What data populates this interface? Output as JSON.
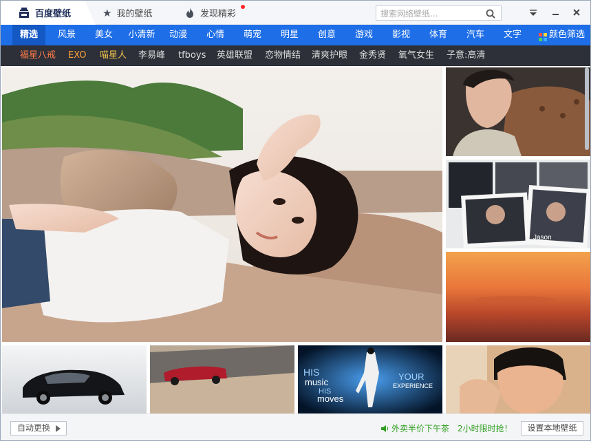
{
  "titlebar": {
    "tabs": [
      {
        "label": "百度壁纸",
        "icon": "baidu-wallpaper-logo-icon"
      },
      {
        "label": "我的壁纸",
        "icon": "star-icon"
      },
      {
        "label": "发现精彩",
        "icon": "flame-icon",
        "badge": "new-dot"
      }
    ],
    "search": {
      "placeholder": "搜索网络壁纸..."
    },
    "window_buttons": [
      "menu-icon",
      "minimize-icon",
      "close-icon"
    ]
  },
  "categories": {
    "items": [
      "精选",
      "风景",
      "美女",
      "小清新",
      "动漫",
      "心情",
      "萌宠",
      "明星",
      "创意",
      "游戏",
      "影视",
      "体育",
      "汽车",
      "文字",
      "颜色筛选"
    ],
    "active": "精选"
  },
  "tags": {
    "items": [
      "福星八戒",
      "EXO",
      "喵星人",
      "李易峰",
      "tfboys",
      "英雄联盟",
      "恋物情结",
      "清爽护眼",
      "金秀贤",
      "氧气女生",
      "子意:高清"
    ],
    "colors": [
      "#ff7a45",
      "#ffa23a",
      "#f1c24a",
      "#dcdcdc",
      "#dcdcdc",
      "#dcdcdc",
      "#dcdcdc",
      "#dcdcdc",
      "#dcdcdc",
      "#dcdcdc",
      "#dcdcdc"
    ]
  },
  "grid": {
    "tiles": [
      {
        "name": "featured-woman-on-rocks"
      },
      {
        "name": "man-on-leather-sofa"
      },
      {
        "name": "singer-photo-collage",
        "caption": "Jason"
      },
      {
        "name": "orange-sunset-sky"
      },
      {
        "name": "black-sedan-car"
      },
      {
        "name": "red-convertible-car"
      },
      {
        "name": "his-music-his-moves-dancer",
        "lines": [
          "HIS",
          "music",
          "HIS",
          "moves",
          "YOUR",
          "EXPERIENCE"
        ]
      },
      {
        "name": "young-man-portrait"
      }
    ]
  },
  "footer": {
    "auto_change": "自动更换",
    "ad_text_1": "外卖半价下午茶",
    "ad_text_2": "2小时限时抢！",
    "set_local": "设置本地壁纸"
  },
  "colors": {
    "category_bar": "#1e6ee8",
    "category_active": "#1458c4",
    "tag_bar": "#2d3039",
    "ad_green": "#2f9e20"
  }
}
